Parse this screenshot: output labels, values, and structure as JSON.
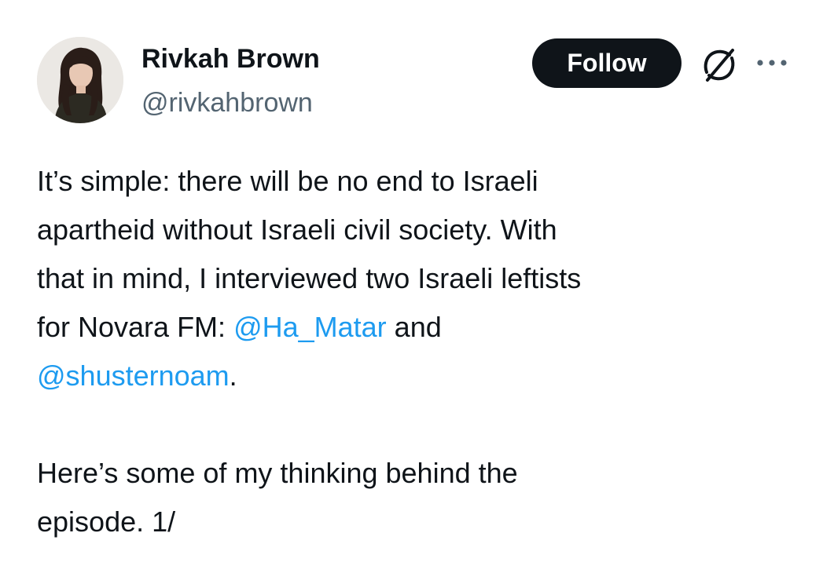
{
  "author": {
    "name": "Rivkah Brown",
    "handle": "@rivkahbrown"
  },
  "actions": {
    "follow_label": "Follow",
    "grok_icon": "grok-icon",
    "more_icon": "more-icon"
  },
  "tweet": {
    "para1": {
      "line1": "It’s simple: there will be no end to Israeli",
      "line2": "apartheid without Israeli civil society. With",
      "line3": "that in mind, I interviewed two Israeli leftists",
      "line4_before": "for Novara FM: ",
      "mention1": "@Ha_Matar",
      "line4_after": " and",
      "mention2": "@shusternoam",
      "line5_after": "."
    },
    "para2": {
      "line1": "Here’s some of my thinking behind the",
      "line2": "episode. 1/"
    }
  },
  "colors": {
    "text": "#0f1419",
    "secondary": "#536471",
    "link": "#1d9bf0",
    "follow_bg": "#0f1419",
    "follow_text": "#ffffff"
  }
}
